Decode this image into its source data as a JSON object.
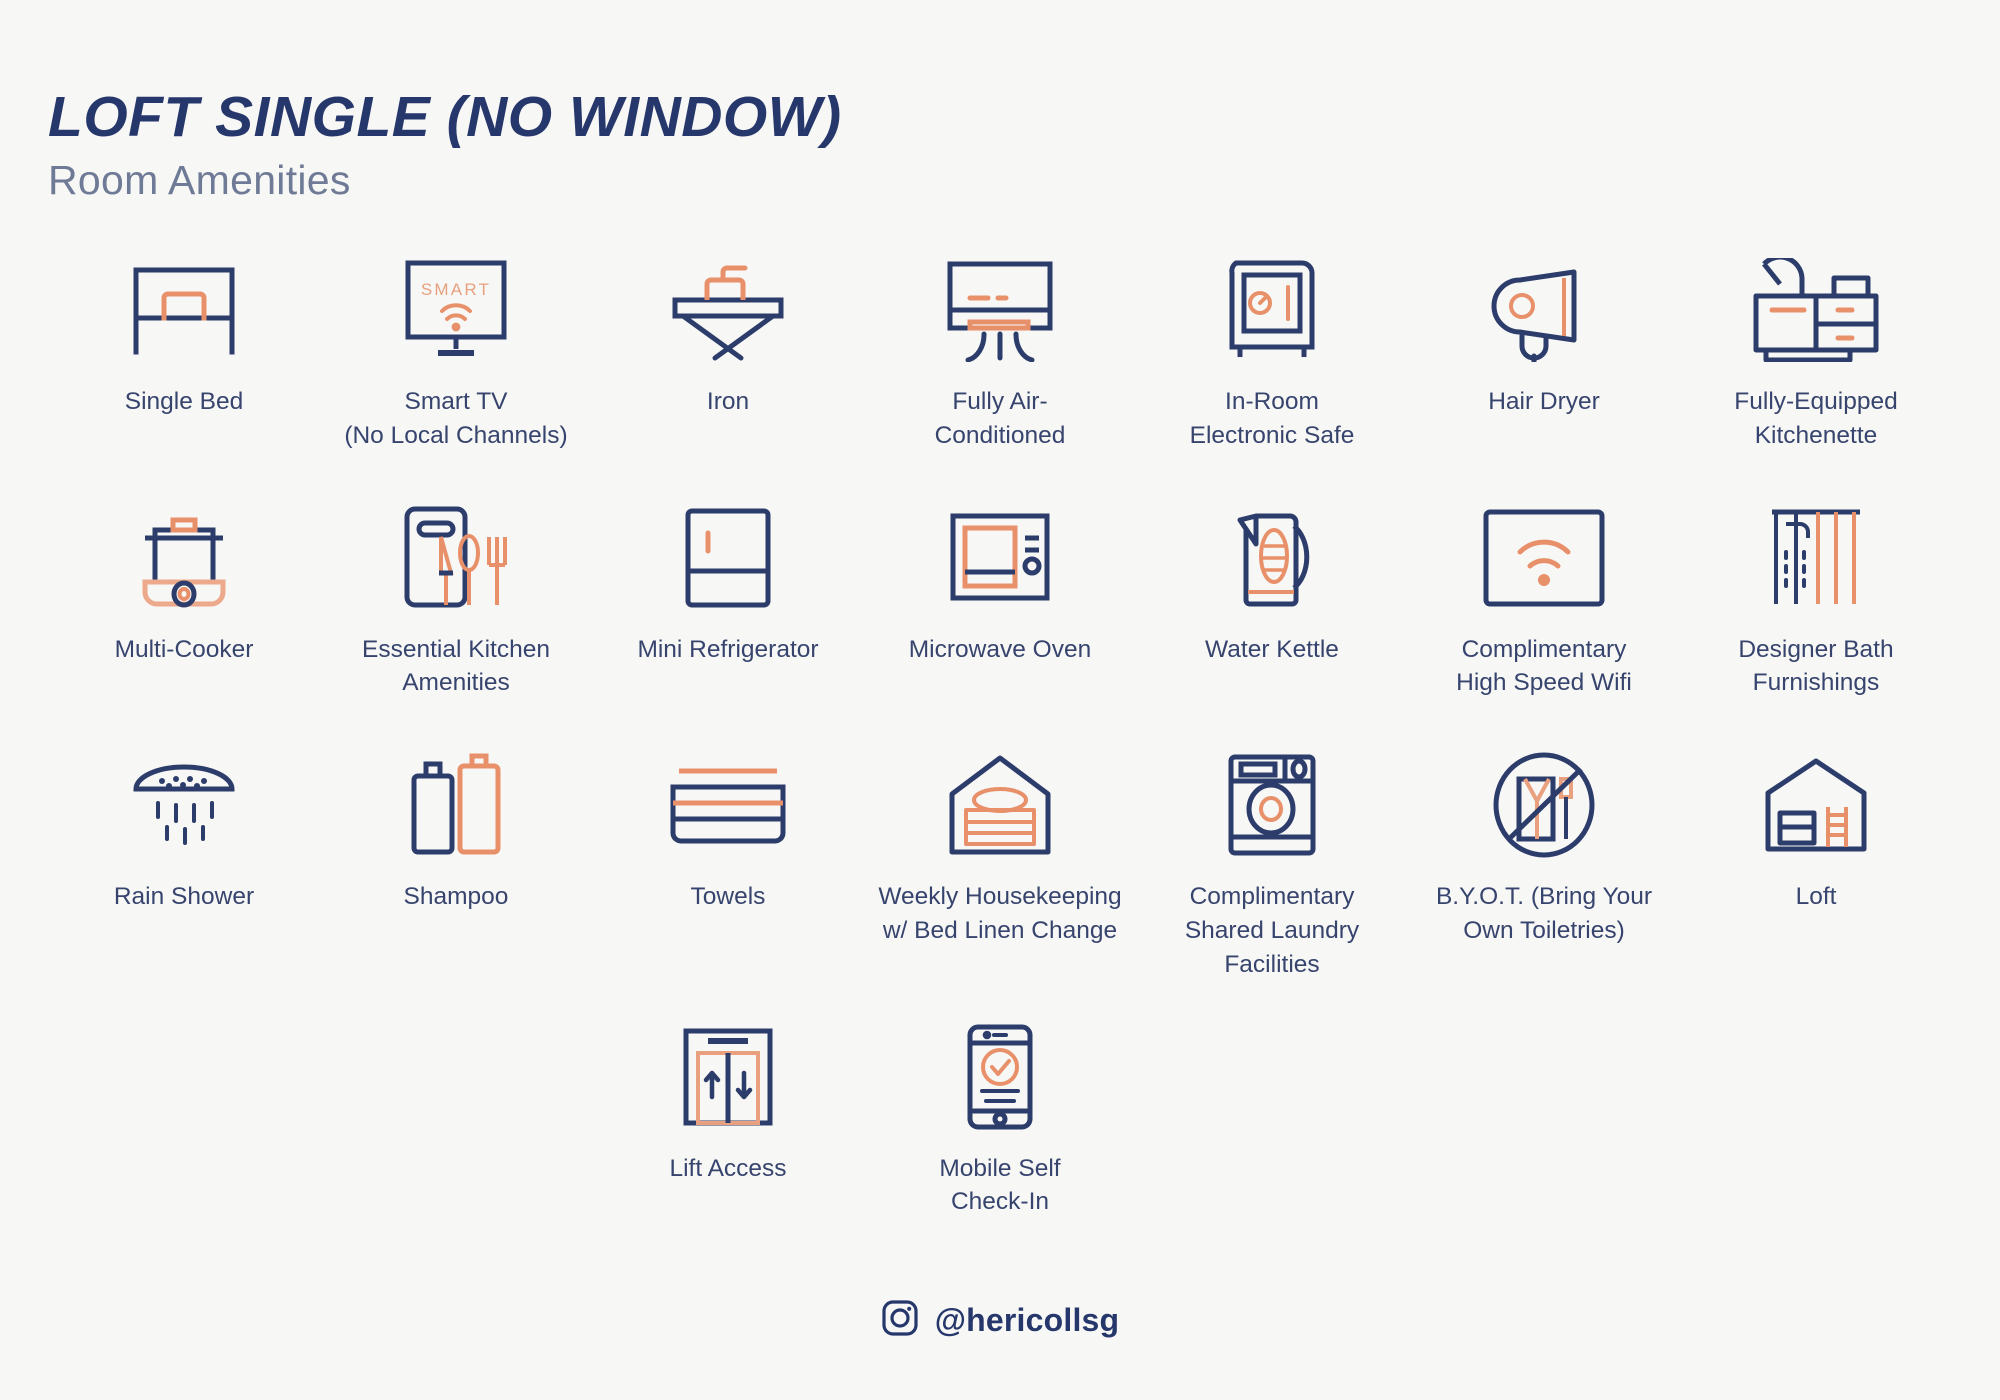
{
  "header": {
    "title": "LOFT SINGLE (NO WINDOW)",
    "subtitle": "Room Amenities"
  },
  "colors": {
    "background": "#f7f7f5",
    "navy": "#2c3c६b",
    "navy_text": "#37446e",
    "title_navy": "#26376b",
    "subtitle_gray": "#6f7a96",
    "orange": "#e8906a",
    "orange_light": "#eda98b"
  },
  "amenities": [
    {
      "icon": "single-bed-icon",
      "label": "Single Bed"
    },
    {
      "icon": "smart-tv-icon",
      "label": "Smart TV\n(No Local Channels)",
      "icon_text": "SMART"
    },
    {
      "icon": "iron-icon",
      "label": "Iron"
    },
    {
      "icon": "air-conditioner-icon",
      "label": "Fully Air-\nConditioned"
    },
    {
      "icon": "electronic-safe-icon",
      "label": "In-Room\nElectronic Safe"
    },
    {
      "icon": "hair-dryer-icon",
      "label": "Hair Dryer"
    },
    {
      "icon": "kitchenette-icon",
      "label": "Fully-Equipped\nKitchenette"
    },
    {
      "icon": "multi-cooker-icon",
      "label": "Multi-Cooker"
    },
    {
      "icon": "kitchen-utensils-icon",
      "label": "Essential Kitchen\nAmenities"
    },
    {
      "icon": "mini-refrigerator-icon",
      "label": "Mini Refrigerator"
    },
    {
      "icon": "microwave-oven-icon",
      "label": "Microwave Oven"
    },
    {
      "icon": "water-kettle-icon",
      "label": "Water Kettle"
    },
    {
      "icon": "wifi-icon",
      "label": "Complimentary\nHigh Speed Wifi"
    },
    {
      "icon": "bath-furnishings-icon",
      "label": "Designer Bath\nFurnishings"
    },
    {
      "icon": "rain-shower-icon",
      "label": "Rain Shower"
    },
    {
      "icon": "shampoo-bottles-icon",
      "label": "Shampoo"
    },
    {
      "icon": "towels-icon",
      "label": "Towels"
    },
    {
      "icon": "housekeeping-linen-icon",
      "label": "Weekly Housekeeping\nw/ Bed Linen Change"
    },
    {
      "icon": "washing-machine-icon",
      "label": "Complimentary\nShared Laundry\nFacilities"
    },
    {
      "icon": "no-toiletries-icon",
      "label": "B.Y.O.T. (Bring Your\nOwn Toiletries)"
    },
    {
      "icon": "loft-icon",
      "label": "Loft"
    },
    {
      "icon": "lift-access-icon",
      "label": "Lift Access"
    },
    {
      "icon": "mobile-check-in-icon",
      "label": "Mobile Self\nCheck-In"
    }
  ],
  "footer": {
    "icon": "instagram-icon",
    "handle": "@hericollsg"
  }
}
